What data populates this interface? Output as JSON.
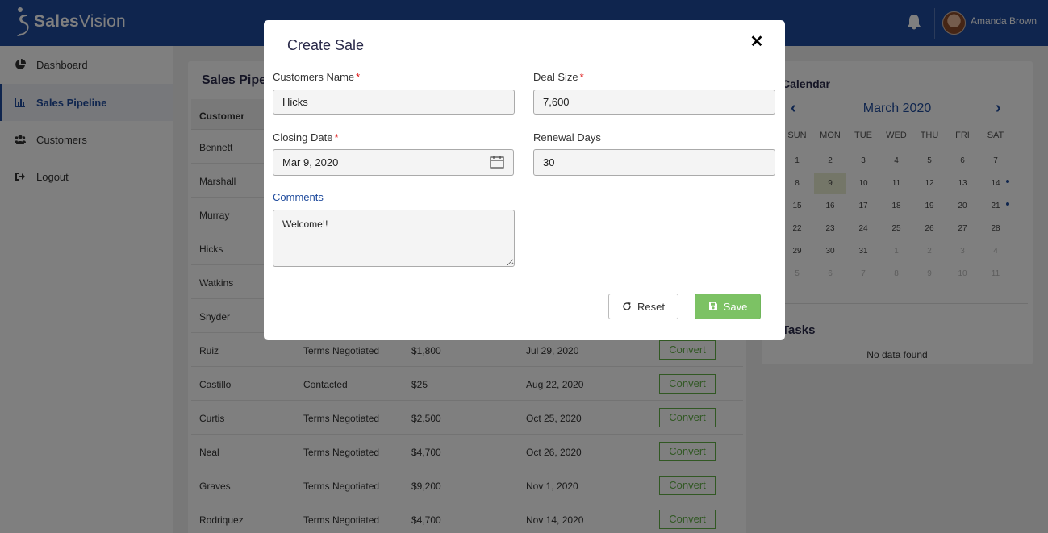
{
  "header": {
    "logo_brand": "Sales",
    "logo_brand_thin": "Vision",
    "user_name": "Amanda Brown"
  },
  "sidebar": {
    "items": [
      {
        "label": "Dashboard",
        "icon": "pie-chart-icon"
      },
      {
        "label": "Sales Pipeline",
        "icon": "bar-chart-icon"
      },
      {
        "label": "Customers",
        "icon": "users-icon"
      },
      {
        "label": "Logout",
        "icon": "sign-out-icon"
      }
    ],
    "active_index": 1
  },
  "pipeline": {
    "title": "Sales Pipe",
    "columns": [
      "Customer"
    ],
    "convert_label": "Convert",
    "rows": [
      {
        "customer": "Bennett",
        "stage": "",
        "size": "",
        "date": ""
      },
      {
        "customer": "Marshall",
        "stage": "",
        "size": "",
        "date": ""
      },
      {
        "customer": "Murray",
        "stage": "",
        "size": "",
        "date": ""
      },
      {
        "customer": "Hicks",
        "stage": "",
        "size": "",
        "date": ""
      },
      {
        "customer": "Watkins",
        "stage": "",
        "size": "",
        "date": ""
      },
      {
        "customer": "Snyder",
        "stage": "",
        "size": "",
        "date": ""
      },
      {
        "customer": "Ruiz",
        "stage": "Terms Negotiated",
        "size": "$1,800",
        "date": "Jul 29, 2020"
      },
      {
        "customer": "Castillo",
        "stage": "Contacted",
        "size": "$25",
        "date": "Aug 22, 2020"
      },
      {
        "customer": "Curtis",
        "stage": "Terms Negotiated",
        "size": "$2,500",
        "date": "Oct 25, 2020"
      },
      {
        "customer": "Neal",
        "stage": "Terms Negotiated",
        "size": "$4,700",
        "date": "Oct 26, 2020"
      },
      {
        "customer": "Graves",
        "stage": "Terms Negotiated",
        "size": "$9,200",
        "date": "Nov 1, 2020"
      },
      {
        "customer": "Rodriquez",
        "stage": "Terms Negotiated",
        "size": "$4,700",
        "date": "Nov 14, 2020"
      }
    ]
  },
  "calendar": {
    "title": "Calendar",
    "month": "March 2020",
    "prev": "‹",
    "next": "›",
    "weekdays": [
      "SUN",
      "MON",
      "TUE",
      "WED",
      "THU",
      "FRI",
      "SAT"
    ],
    "weeks": [
      [
        "1",
        "2",
        "3",
        "4",
        "5",
        "6",
        "7"
      ],
      [
        "8",
        "9",
        "10",
        "11",
        "12",
        "13",
        "14"
      ],
      [
        "15",
        "16",
        "17",
        "18",
        "19",
        "20",
        "21"
      ],
      [
        "22",
        "23",
        "24",
        "25",
        "26",
        "27",
        "28"
      ],
      [
        "29",
        "30",
        "31",
        "1",
        "2",
        "3",
        "4"
      ],
      [
        "5",
        "6",
        "7",
        "8",
        "9",
        "10",
        "11"
      ]
    ],
    "selected_day": "9",
    "event_days": [
      "14",
      "21"
    ]
  },
  "tasks": {
    "title": "Tasks",
    "empty_text": "No data found"
  },
  "modal": {
    "title": "Create Sale",
    "close_label": "✕",
    "customer_name": {
      "label": "Customers Name",
      "required": "*",
      "value": "Hicks"
    },
    "deal_size": {
      "label": "Deal Size",
      "required": "*",
      "value": "7,600"
    },
    "closing_date": {
      "label": "Closing Date",
      "required": "*",
      "value": "Mar 9, 2020"
    },
    "renewal_days": {
      "label": "Renewal Days",
      "value": "30"
    },
    "comments": {
      "label": "Comments",
      "value": "Welcome!!"
    },
    "reset_label": "Reset",
    "save_label": "Save"
  },
  "colors": {
    "brand": "#1e4a9c",
    "convert_green": "#62b046",
    "save_green": "#7cc264",
    "required_red": "#dd1111"
  }
}
